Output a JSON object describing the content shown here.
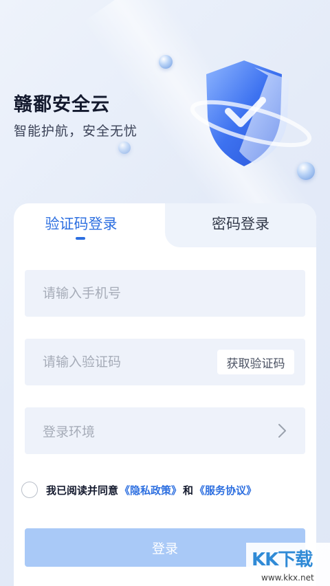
{
  "header": {
    "title": "赣鄱安全云",
    "subtitle": "智能护航，安全无忧"
  },
  "tabs": {
    "code_login": "验证码登录",
    "password_login": "密码登录"
  },
  "form": {
    "phone_placeholder": "请输入手机号",
    "code_placeholder": "请输入验证码",
    "get_code_label": "获取验证码",
    "environment_label": "登录环境"
  },
  "agreement": {
    "prefix": "我已阅读并同意",
    "privacy": "《隐私政策》",
    "and": "和",
    "service": "《服务协议》"
  },
  "login_button": "登录",
  "watermark": {
    "logo": "KK下载",
    "url": "www.kkx.net"
  },
  "colors": {
    "accent": "#2d6fe0",
    "button_disabled": "#a9c9f7",
    "field_bg": "#eef2fa"
  }
}
